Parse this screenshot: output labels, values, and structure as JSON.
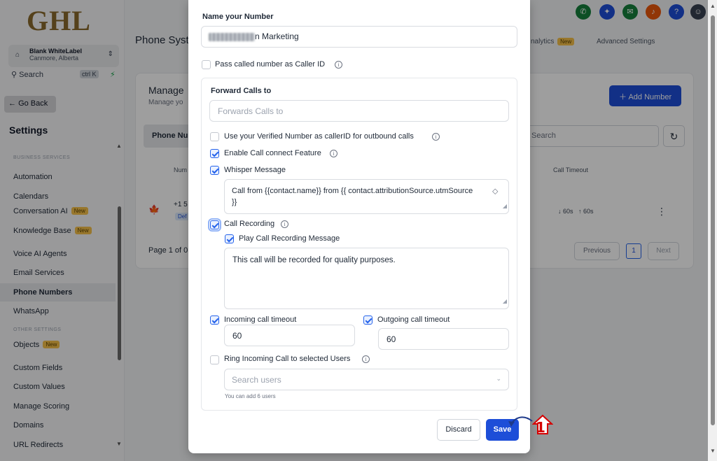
{
  "app": {
    "logo": "GHL",
    "account_name": "Blank WhiteLabel",
    "account_location": "Canmore, Alberta",
    "search_label": "Search",
    "search_shortcut": "ctrl K",
    "go_back": "Go Back",
    "settings_title": "Settings"
  },
  "sidebar": {
    "section_business": "BUSINESS SERVICES",
    "section_other": "OTHER SETTINGS",
    "items": [
      {
        "label": "Automation"
      },
      {
        "label": "Calendars"
      },
      {
        "label": "Conversation AI",
        "badge": "New"
      },
      {
        "label": "Knowledge Base",
        "badge": "New"
      },
      {
        "label": "Voice AI Agents"
      },
      {
        "label": "Email Services"
      },
      {
        "label": "Phone Numbers"
      },
      {
        "label": "WhatsApp"
      },
      {
        "label": "Objects",
        "badge": "New"
      },
      {
        "label": "Custom Fields"
      },
      {
        "label": "Custom Values"
      },
      {
        "label": "Manage Scoring"
      },
      {
        "label": "Domains"
      },
      {
        "label": "URL Redirects"
      }
    ]
  },
  "header": {
    "title": "Phone Syst",
    "tab_analytics": "nalytics",
    "tab_analytics_badge": "New",
    "tab_advanced": "Advanced Settings"
  },
  "page": {
    "manage_title": "Manage",
    "manage_subtitle": "Manage yo",
    "add_number": "Add Number",
    "tab_phone": "Phone Nu",
    "search_placeholder": "Search",
    "col_number": "Num",
    "col_timeout": "Call Timeout",
    "row_number": "+1 5",
    "row_badge": "Def",
    "row_timeout_in": "60s",
    "row_timeout_out": "60s",
    "page_of": "Page 1 of 0",
    "prev": "Previous",
    "current_page": "1",
    "next": "Next"
  },
  "modal": {
    "name_label": "Name your Number",
    "name_value_visible": "n Marketing",
    "caller_id_label": "Pass called number as Caller ID",
    "forward_label": "Forward Calls to",
    "forward_placeholder": "Forwards Calls to",
    "verified_label": "Use your Verified Number as callerID for outbound calls",
    "call_connect_label": "Enable Call connect Feature",
    "whisper_label": "Whisper Message",
    "whisper_value_line1": "Call from {{contact.name}} from {{ contact.attributionSource.utmSource",
    "whisper_value_line2": "}}",
    "recording_label": "Call Recording",
    "play_recording_label": "Play Call Recording Message",
    "recording_message": "This call will be recorded for quality purposes.",
    "incoming_timeout_label": "Incoming call timeout",
    "incoming_timeout_value": "60",
    "outgoing_timeout_label": "Outgoing call timeout",
    "outgoing_timeout_value": "60",
    "ring_users_label": "Ring Incoming Call to selected Users",
    "search_users_placeholder": "Search users",
    "users_helper": "You can add 6 users",
    "discard": "Discard",
    "save": "Save",
    "callout_number": "1"
  },
  "colors": {
    "primary": "#1d4ed8",
    "callout": "#d50000",
    "new_badge": "#f5c04a"
  },
  "icons": [
    "phone-icon",
    "sparkle-icon",
    "megaphone-icon",
    "bell-icon",
    "help-icon",
    "avatar"
  ]
}
